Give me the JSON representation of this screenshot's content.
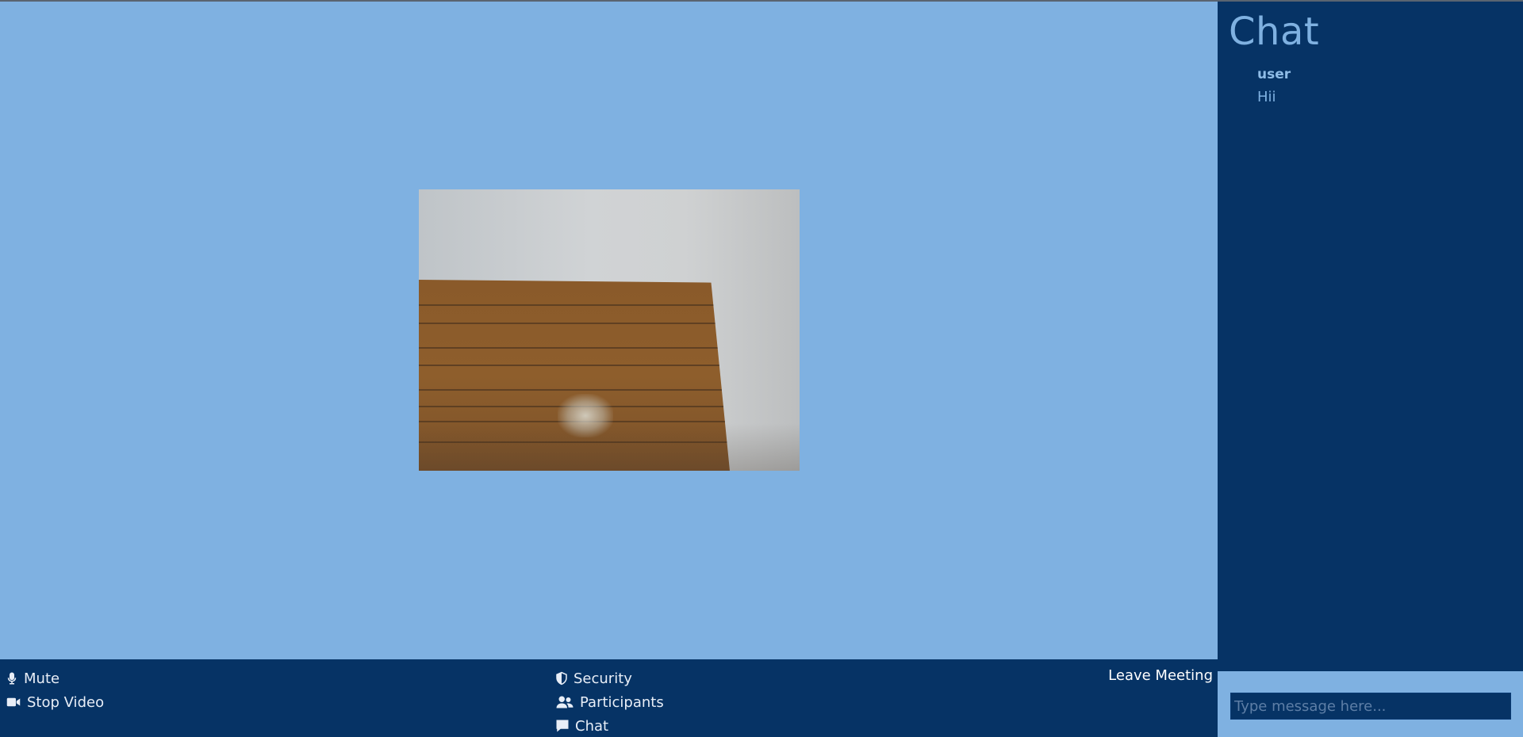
{
  "controls": {
    "mute_label": "Mute",
    "stop_video_label": "Stop Video",
    "security_label": "Security",
    "participants_label": "Participants",
    "chat_label": "Chat",
    "leave_label": "Leave Meeting"
  },
  "chat": {
    "title": "Chat",
    "messages": [
      {
        "user": "user",
        "text": "Hii"
      }
    ],
    "input_placeholder": "Type message here...",
    "input_value": ""
  },
  "icons": {
    "mute": "microphone-icon",
    "stop_video": "video-camera-icon",
    "security": "shield-icon",
    "participants": "users-icon",
    "chat": "chat-bubble-icon"
  },
  "colors": {
    "main_background": "#7fb1e1",
    "panel_background": "#063365",
    "chat_title": "#7fb1e1",
    "toolbar_text": "#e8eef7"
  }
}
